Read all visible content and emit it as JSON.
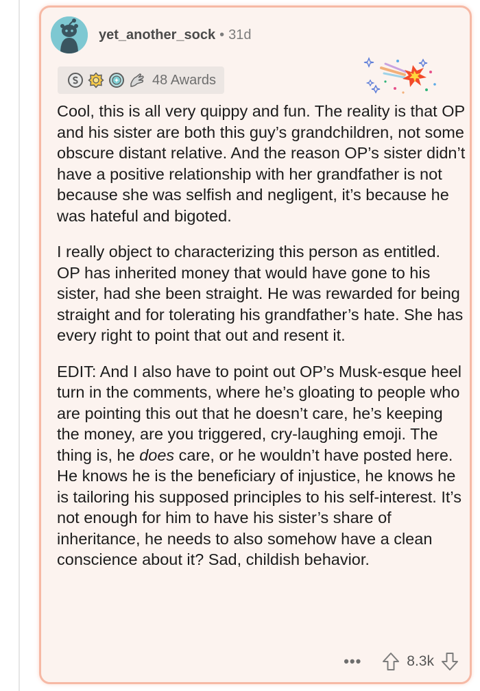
{
  "comment": {
    "username": "yet_another_sock",
    "separator": "•",
    "age": "31d",
    "awards_label": "48 Awards",
    "award_icons": [
      "silver-award-icon",
      "gold-award-icon",
      "platinum-award-icon",
      "hand-award-icon"
    ],
    "paragraphs": [
      "Cool, this is all very quippy and fun. The reality is that OP and his sister are both this guy’s grandchildren, not some obscure distant relative. And the reason OP’s sister didn’t have a positive relationship with her grandfather is not because she was selfish and negligent, it’s because he was hateful and bigoted.",
      "I really object to characterizing this person as entitled. OP has inherited money that would have gone to his sister, had she been straight. He was rewarded for being straight and for tolerating his grandfather’s hate. She has every right to point that out and resent it."
    ],
    "edit_paragraph": {
      "before": "EDIT: And I also have to point out OP’s Musk-esque heel turn in the comments, where he’s gloating to people who are pointing this out that he doesn’t care, he’s keeping the money, are you triggered, cry-laughing emoji. The thing is, he ",
      "emphasis": "does",
      "after": " care, or he wouldn’t have posted here. He knows he is the beneficiary of injustice, he knows he is tailoring his supposed principles to his self-interest. It’s not enough for him to have his sister’s share of inheritance, he needs to also somehow have a clean conscience about it? Sad, childish behavior."
    },
    "more_label": "•••",
    "score": "8.3k",
    "highlight_color": "#f6b9a5",
    "background_color": "#fcf3ef"
  }
}
